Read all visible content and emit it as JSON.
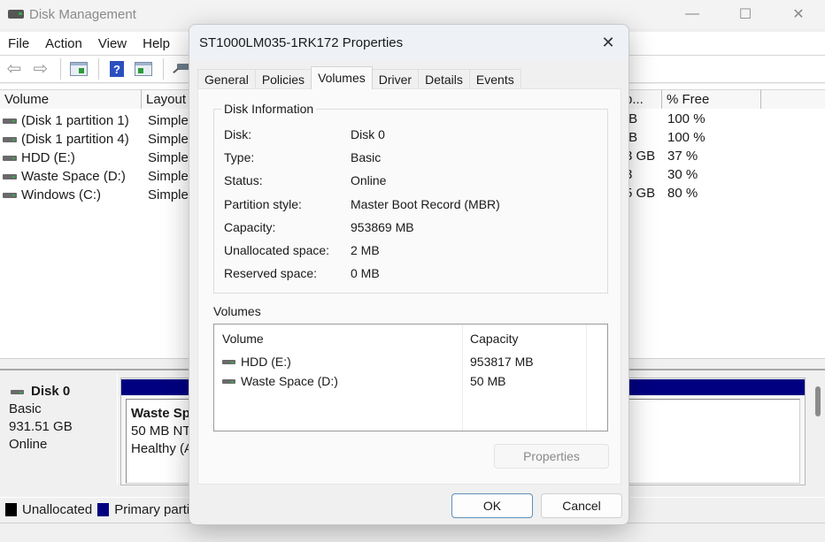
{
  "app": {
    "title": "Disk Management",
    "window_controls": {
      "minimize": "—",
      "maximize": "☐",
      "close": "✕"
    }
  },
  "menu": [
    "File",
    "Action",
    "View",
    "Help"
  ],
  "toolbar": {
    "buttons": [
      "back-icon",
      "forward-icon",
      "show-hide-console-tree-icon",
      "help-icon",
      "show-hide-action-pane-icon",
      "rescan-disks-icon"
    ],
    "help_glyph": "?",
    "back_glyph": "⇦",
    "forward_glyph": "⇨"
  },
  "volume_list": {
    "columns": [
      "Volume",
      "Layout",
      "p...",
      "% Free"
    ],
    "rows": [
      {
        "volume": "(Disk 1 partition 1)",
        "layout": "Simple",
        "capacity_partial": "IB",
        "free_pct": "100 %"
      },
      {
        "volume": "(Disk 1 partition 4)",
        "layout": "Simple",
        "capacity_partial": "IB",
        "free_pct": "100 %"
      },
      {
        "volume": "HDD (E:)",
        "layout": "Simple",
        "capacity_partial": "3 GB",
        "free_pct": "37 %"
      },
      {
        "volume": "Waste Space (D:)",
        "layout": "Simple",
        "capacity_partial": "3",
        "free_pct": "30 %"
      },
      {
        "volume": "Windows (C:)",
        "layout": "Simple",
        "capacity_partial": "5 GB",
        "free_pct": "80 %"
      }
    ]
  },
  "disk_map": {
    "disk": {
      "name": "Disk 0",
      "type": "Basic",
      "size": "931.51 GB",
      "status": "Online"
    },
    "partition": {
      "name": "Waste Sp",
      "detail": "50 MB NT",
      "health": "Healthy (A"
    }
  },
  "legend": [
    {
      "label": "Unallocated",
      "color": "#000000"
    },
    {
      "label": "Primary parti",
      "color": "#000080"
    }
  ],
  "dialog": {
    "title": "ST1000LM035-1RK172 Properties",
    "close_glyph": "✕",
    "tabs": [
      "General",
      "Policies",
      "Volumes",
      "Driver",
      "Details",
      "Events"
    ],
    "active_tab": "Volumes",
    "disk_info": {
      "group_title": "Disk Information",
      "rows": [
        {
          "label": "Disk:",
          "value": "Disk 0"
        },
        {
          "label": "Type:",
          "value": "Basic"
        },
        {
          "label": "Status:",
          "value": "Online"
        },
        {
          "label": "Partition style:",
          "value": "Master Boot Record (MBR)"
        },
        {
          "label": "Capacity:",
          "value": "953869 MB"
        },
        {
          "label": "Unallocated space:",
          "value": "2 MB"
        },
        {
          "label": "Reserved space:",
          "value": "0 MB"
        }
      ]
    },
    "volumes": {
      "label": "Volumes",
      "columns": [
        "Volume",
        "Capacity"
      ],
      "rows": [
        {
          "volume": "HDD (E:)",
          "capacity": "953817 MB"
        },
        {
          "volume": "Waste Space (D:)",
          "capacity": "50 MB"
        }
      ]
    },
    "properties_button": "Properties",
    "ok_button": "OK",
    "cancel_button": "Cancel"
  }
}
